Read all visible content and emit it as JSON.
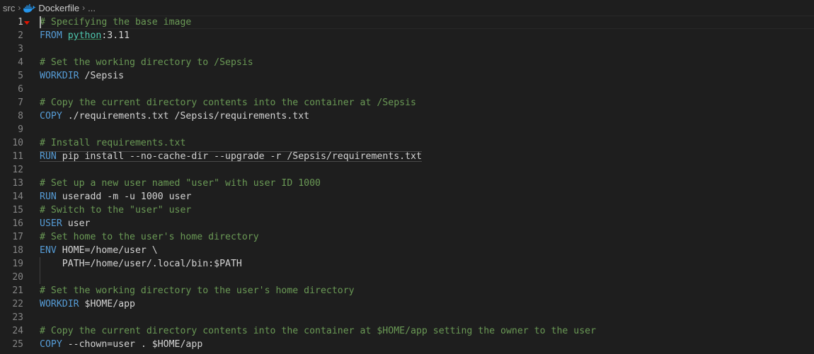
{
  "breadcrumb": {
    "folder": "src",
    "file": "Dockerfile",
    "more": "..."
  },
  "colors": {
    "background": "#1e1e1e",
    "comment": "#6a9955",
    "keyword": "#569cd6",
    "text": "#d4d4d4",
    "image": "#4ec9b0",
    "line_number": "#858585"
  },
  "icons": {
    "file_icon": "docker-icon",
    "separator": "chevron-right-icon"
  },
  "lines": [
    {
      "number": "1",
      "tokens": [
        {
          "t": "comment",
          "v": "# Specifying the base image"
        }
      ]
    },
    {
      "number": "2",
      "tokens": [
        {
          "t": "keyword",
          "v": "FROM"
        },
        {
          "t": "plain",
          "v": " "
        },
        {
          "t": "image",
          "v": "python"
        },
        {
          "t": "plain",
          "v": ":3.11"
        }
      ]
    },
    {
      "number": "3",
      "tokens": []
    },
    {
      "number": "4",
      "tokens": [
        {
          "t": "comment",
          "v": "# Set the working directory to /Sepsis"
        }
      ]
    },
    {
      "number": "5",
      "tokens": [
        {
          "t": "keyword",
          "v": "WORKDIR"
        },
        {
          "t": "plain",
          "v": " /Sepsis"
        }
      ]
    },
    {
      "number": "6",
      "tokens": []
    },
    {
      "number": "7",
      "tokens": [
        {
          "t": "comment",
          "v": "# Copy the current directory contents into the container at /Sepsis"
        }
      ]
    },
    {
      "number": "8",
      "tokens": [
        {
          "t": "keyword",
          "v": "COPY"
        },
        {
          "t": "plain",
          "v": " ./requirements.txt /Sepsis/requirements.txt"
        }
      ]
    },
    {
      "number": "9",
      "tokens": []
    },
    {
      "number": "10",
      "tokens": [
        {
          "t": "comment",
          "v": "# Install requirements.txt"
        }
      ]
    },
    {
      "number": "11",
      "tokens": [
        {
          "t": "keyword",
          "v": "RUN"
        },
        {
          "t": "plain",
          "v": " pip install --no-cache-dir --upgrade -r /Sepsis/requirements.txt"
        }
      ]
    },
    {
      "number": "12",
      "tokens": []
    },
    {
      "number": "13",
      "tokens": [
        {
          "t": "comment",
          "v": "# Set up a new user named \"user\" with user ID 1000"
        }
      ]
    },
    {
      "number": "14",
      "tokens": [
        {
          "t": "keyword",
          "v": "RUN"
        },
        {
          "t": "plain",
          "v": " useradd -m -u 1000 user"
        }
      ]
    },
    {
      "number": "15",
      "tokens": [
        {
          "t": "comment",
          "v": "# Switch to the \"user\" user"
        }
      ]
    },
    {
      "number": "16",
      "tokens": [
        {
          "t": "keyword",
          "v": "USER"
        },
        {
          "t": "plain",
          "v": " user"
        }
      ]
    },
    {
      "number": "17",
      "tokens": [
        {
          "t": "comment",
          "v": "# Set home to the user's home directory"
        }
      ]
    },
    {
      "number": "18",
      "tokens": [
        {
          "t": "keyword",
          "v": "ENV"
        },
        {
          "t": "plain",
          "v": " HOME=/home/user \\"
        }
      ]
    },
    {
      "number": "19",
      "tokens": [
        {
          "t": "plain",
          "v": "    PATH=/home/user/.local/bin:$PATH"
        }
      ]
    },
    {
      "number": "20",
      "tokens": []
    },
    {
      "number": "21",
      "tokens": [
        {
          "t": "comment",
          "v": "# Set the working directory to the user's home directory"
        }
      ]
    },
    {
      "number": "22",
      "tokens": [
        {
          "t": "keyword",
          "v": "WORKDIR"
        },
        {
          "t": "plain",
          "v": " $HOME/app"
        }
      ]
    },
    {
      "number": "23",
      "tokens": []
    },
    {
      "number": "24",
      "tokens": [
        {
          "t": "comment",
          "v": "# Copy the current directory contents into the container at $HOME/app setting the owner to the user"
        }
      ]
    },
    {
      "number": "25",
      "tokens": [
        {
          "t": "keyword",
          "v": "COPY"
        },
        {
          "t": "plain",
          "v": " --chown=user . $HOME/app"
        }
      ]
    }
  ]
}
